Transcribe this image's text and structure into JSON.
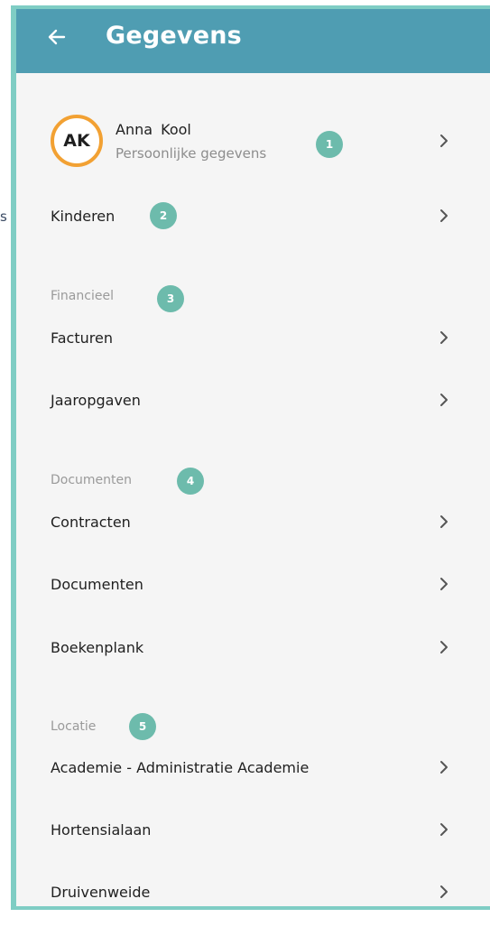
{
  "stray_text": "s",
  "header": {
    "title": "Gegevens",
    "back_icon": "arrow-left-icon",
    "background": "#4f9db2"
  },
  "profile": {
    "initials": "AK",
    "name": "Anna  Kool",
    "subtitle": "Persoonlijke gegevens",
    "badge": "1",
    "ring_color": "#f2a133"
  },
  "kinderen": {
    "label": "Kinderen",
    "badge": "2"
  },
  "sections": {
    "financieel": {
      "title": "Financieel",
      "badge": "3",
      "items": [
        "Facturen",
        "Jaaropgaven"
      ]
    },
    "documenten": {
      "title": "Documenten",
      "badge": "4",
      "items": [
        "Contracten",
        "Documenten",
        "Boekenplank"
      ]
    },
    "locatie": {
      "title": "Locatie",
      "badge": "5",
      "items": [
        "Academie - Administratie Academie",
        "Hortensialaan",
        "Druivenweide"
      ]
    }
  },
  "colors": {
    "badge": "#6dbbac",
    "frame_border": "#7fcdc4",
    "background": "#f5f5f5"
  },
  "icons": {
    "row_chevron": "chevron-right-icon"
  }
}
